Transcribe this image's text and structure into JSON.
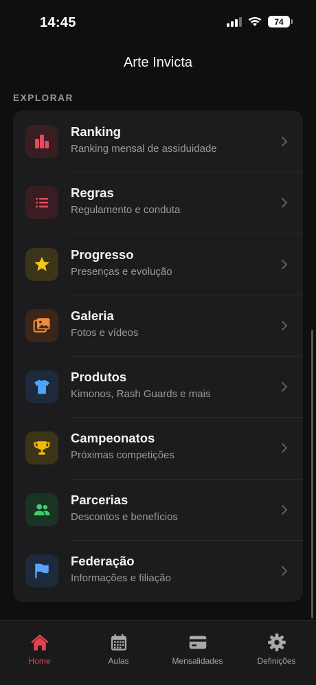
{
  "status_bar": {
    "time": "14:45",
    "battery": "74"
  },
  "header": {
    "title": "Arte Invicta"
  },
  "section": {
    "label": "EXPLORAR"
  },
  "menu": {
    "items": [
      {
        "title": "Ranking",
        "subtitle": "Ranking mensal de assiduidade",
        "icon": "bar-chart-icon",
        "color": "#e34b5c"
      },
      {
        "title": "Regras",
        "subtitle": "Regulamento e conduta",
        "icon": "list-icon",
        "color": "#e34b5c"
      },
      {
        "title": "Progresso",
        "subtitle": "Presenças e evolução",
        "icon": "star-icon",
        "color": "#f5c518"
      },
      {
        "title": "Galeria",
        "subtitle": "Fotos e vídeos",
        "icon": "photos-icon",
        "color": "#f28a3c"
      },
      {
        "title": "Produtos",
        "subtitle": "Kimonos, Rash Guards e mais",
        "icon": "tshirt-icon",
        "color": "#4da3ff"
      },
      {
        "title": "Campeonatos",
        "subtitle": "Próximas competições",
        "icon": "trophy-icon",
        "color": "#f5b90a"
      },
      {
        "title": "Parcerias",
        "subtitle": "Descontos e benefícios",
        "icon": "people-icon",
        "color": "#3dd068"
      },
      {
        "title": "Federação",
        "subtitle": "Informações e filiação",
        "icon": "flag-icon",
        "color": "#5aa2ff"
      }
    ]
  },
  "tab_bar": {
    "tabs": [
      {
        "label": "Home",
        "icon": "home-icon",
        "active": true
      },
      {
        "label": "Aulas",
        "icon": "calendar-icon",
        "active": false
      },
      {
        "label": "Mensalidades",
        "icon": "credit-card-icon",
        "active": false
      },
      {
        "label": "Definições",
        "icon": "gear-icon",
        "active": false
      }
    ]
  },
  "colors": {
    "accent": "#e0434f",
    "background": "#0f0f0f",
    "card": "#1c1c1e"
  }
}
